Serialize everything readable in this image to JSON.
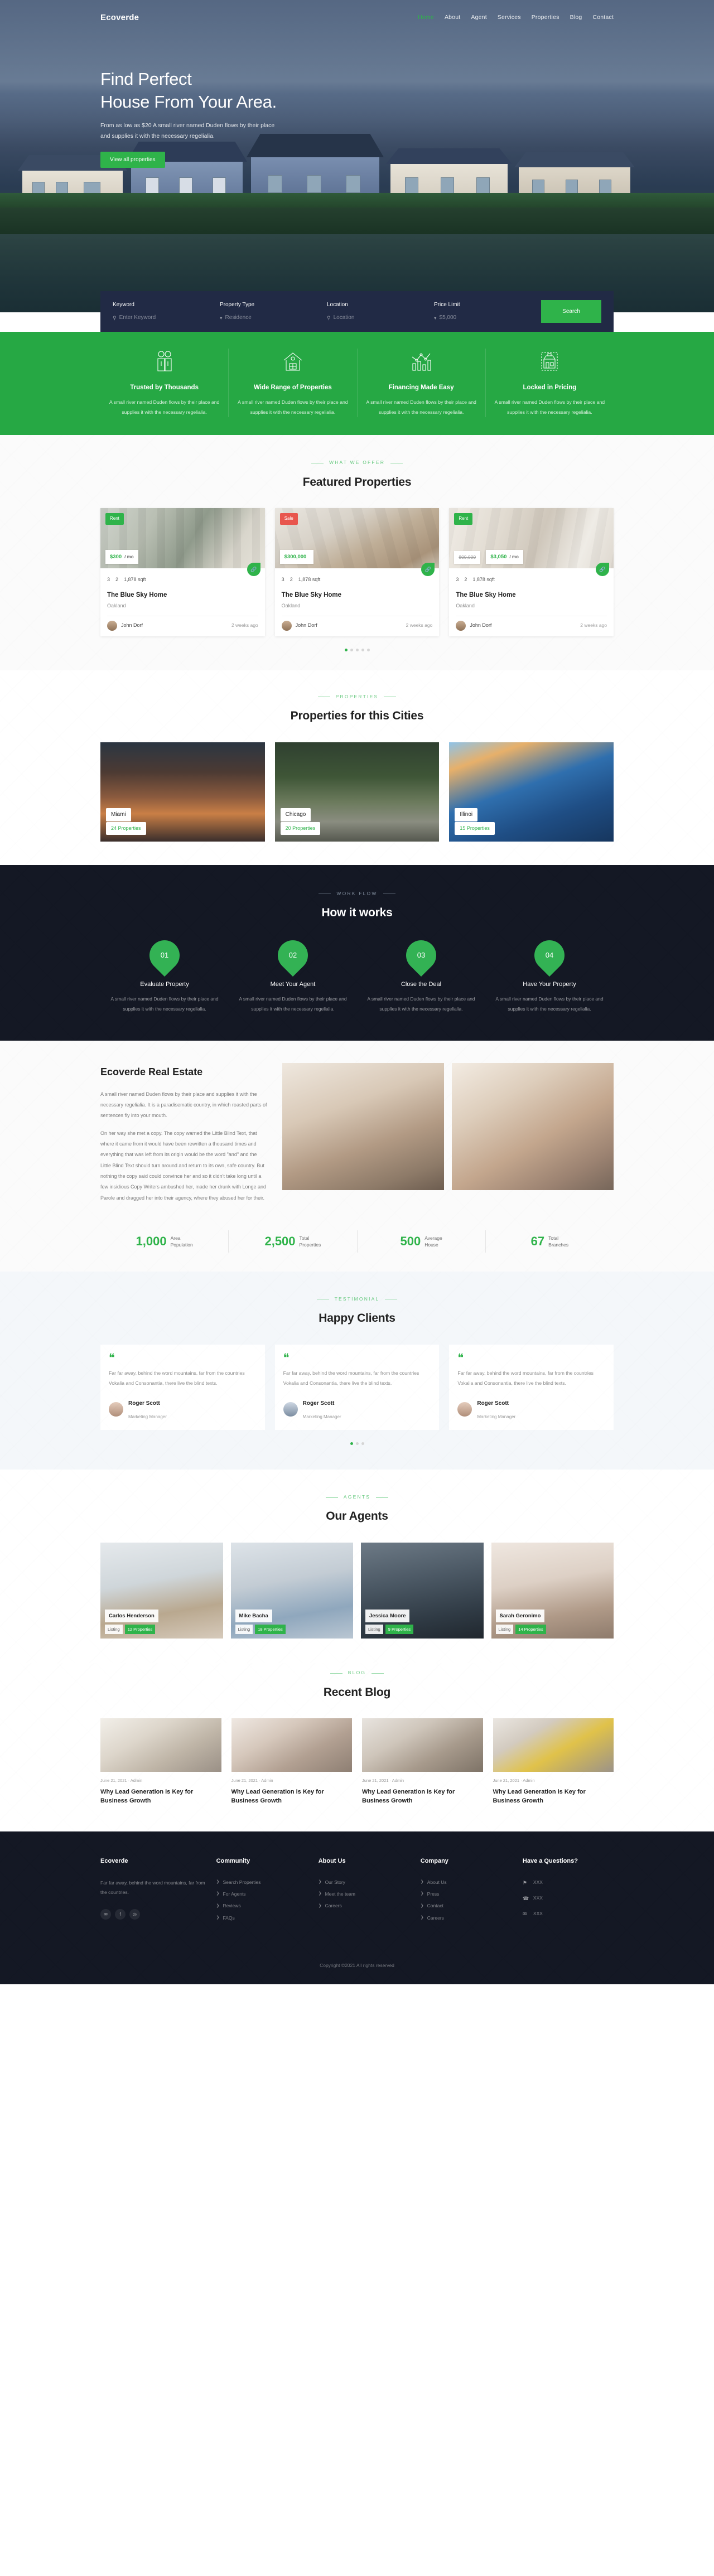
{
  "brand": {
    "name": "Ecoverde"
  },
  "nav": {
    "items": [
      {
        "label": "Home",
        "active": true
      },
      {
        "label": "About",
        "active": false
      },
      {
        "label": "Agent",
        "active": false
      },
      {
        "label": "Services",
        "active": false
      },
      {
        "label": "Properties",
        "active": false
      },
      {
        "label": "Blog",
        "active": false
      },
      {
        "label": "Contact",
        "active": false
      }
    ]
  },
  "hero": {
    "title_line1": "Find Perfect",
    "title_line2": "House From Your Area.",
    "subtitle": "From as low as $20 A small river named Duden flows by their place and supplies it with the necessary regelialia.",
    "cta": "View all properties"
  },
  "search": {
    "fields": [
      {
        "label": "Keyword",
        "value": "Enter Keyword",
        "icon": "search-icon"
      },
      {
        "label": "Property Type",
        "value": "Residence",
        "icon": "chevron-down-icon"
      },
      {
        "label": "Location",
        "value": "Location",
        "icon": "search-icon"
      },
      {
        "label": "Price Limit",
        "value": "$5,000",
        "icon": "chevron-down-icon"
      }
    ],
    "button": "Search"
  },
  "features": {
    "items": [
      {
        "icon": "handshake-icon",
        "title": "Trusted by Thousands",
        "text": "A small river named Duden flows by their place and supplies it with the necessary regelialia."
      },
      {
        "icon": "house-icon",
        "title": "Wide Range of Properties",
        "text": "A small river named Duden flows by their place and supplies it with the necessary regelialia."
      },
      {
        "icon": "chart-icon",
        "title": "Financing Made Easy",
        "text": "A small river named Duden flows by their place and supplies it with the necessary regelialia."
      },
      {
        "icon": "storefront-icon",
        "title": "Locked in Pricing",
        "text": "A small river named Duden flows by their place and supplies it with the necessary regelialia."
      }
    ]
  },
  "featured": {
    "eyebrow": "WHAT WE OFFER",
    "title": "Featured Properties",
    "cards": [
      {
        "badge": "Rent",
        "badge_type": "rent",
        "price": "$300",
        "per": "/ mo",
        "old_price": "",
        "beds": "3",
        "baths": "2",
        "area": "1,878 sqft",
        "name": "The Blue Sky Home",
        "location": "Oakland",
        "agent": "John Dorf",
        "time": "2 weeks ago"
      },
      {
        "badge": "Sale",
        "badge_type": "sale",
        "price": "$300,000",
        "per": "",
        "old_price": "",
        "beds": "3",
        "baths": "2",
        "area": "1,878 sqft",
        "name": "The Blue Sky Home",
        "location": "Oakland",
        "agent": "John Dorf",
        "time": "2 weeks ago"
      },
      {
        "badge": "Rent",
        "badge_type": "rent",
        "price": "$3,050",
        "per": "/ mo",
        "old_price": "800,000",
        "beds": "3",
        "baths": "2",
        "area": "1,878 sqft",
        "name": "The Blue Sky Home",
        "location": "Oakland",
        "agent": "John Dorf",
        "time": "2 weeks ago"
      }
    ]
  },
  "cities": {
    "eyebrow": "PROPERTIES",
    "title": "Properties for this Cities",
    "items": [
      {
        "name": "Miami",
        "count": "24 Properties"
      },
      {
        "name": "Chicago",
        "count": "20 Properties"
      },
      {
        "name": "Illinoi",
        "count": "15 Properties"
      }
    ]
  },
  "howitworks": {
    "eyebrow": "WORK FLOW",
    "title": "How it works",
    "steps": [
      {
        "num": "01",
        "title": "Evaluate Property",
        "text": "A small river named Duden flows by their place and supplies it with the necessary regelialia."
      },
      {
        "num": "02",
        "title": "Meet Your Agent",
        "text": "A small river named Duden flows by their place and supplies it with the necessary regelialia."
      },
      {
        "num": "03",
        "title": "Close the Deal",
        "text": "A small river named Duden flows by their place and supplies it with the necessary regelialia."
      },
      {
        "num": "04",
        "title": "Have Your Property",
        "text": "A small river named Duden flows by their place and supplies it with the necessary regelialia."
      }
    ]
  },
  "about": {
    "title": "Ecoverde Real Estate",
    "p1": "A small river named Duden flows by their place and supplies it with the necessary regelialia. It is a paradisematic country, in which roasted parts of sentences fly into your mouth.",
    "p2": "On her way she met a copy. The copy warned the Little Blind Text, that where it came from it would have been rewritten a thousand times and everything that was left from its origin would be the word \"and\" and the Little Blind Text should turn around and return to its own, safe country. But nothing the copy said could convince her and so it didn't take long until a few insidious Copy Writers ambushed her, made her drunk with Longe and Parole and dragged her into their agency, where they abused her for their."
  },
  "stats": {
    "items": [
      {
        "num": "1,000",
        "label1": "Area",
        "label2": "Population"
      },
      {
        "num": "2,500",
        "label1": "Total",
        "label2": "Properties"
      },
      {
        "num": "500",
        "label1": "Average",
        "label2": "House"
      },
      {
        "num": "67",
        "label1": "Total",
        "label2": "Branches"
      }
    ]
  },
  "testimonials": {
    "eyebrow": "TESTIMONIAL",
    "title": "Happy Clients",
    "items": [
      {
        "text": "Far far away, behind the word mountains, far from the countries Vokalia and Consonantia, there live the blind texts.",
        "name": "Roger Scott",
        "role": "Marketing Manager"
      },
      {
        "text": "Far far away, behind the word mountains, far from the countries Vokalia and Consonantia, there live the blind texts.",
        "name": "Roger Scott",
        "role": "Marketing Manager"
      },
      {
        "text": "Far far away, behind the word mountains, far from the countries Vokalia and Consonantia, there live the blind texts.",
        "name": "Roger Scott",
        "role": "Marketing Manager"
      }
    ]
  },
  "agents": {
    "eyebrow": "AGENTS",
    "title": "Our Agents",
    "items": [
      {
        "name": "Carlos Henderson",
        "listing": "Listing",
        "count": "12 Properties"
      },
      {
        "name": "Mike Bacha",
        "listing": "Listing",
        "count": "18 Properties"
      },
      {
        "name": "Jessica Moore",
        "listing": "Listing",
        "count": "9 Properties"
      },
      {
        "name": "Sarah Geronimo",
        "listing": "Listing",
        "count": "14 Properties"
      }
    ]
  },
  "blog": {
    "eyebrow": "BLOG",
    "title": "Recent Blog",
    "items": [
      {
        "meta": "June 21, 2021 · Admin",
        "title": "Why Lead Generation is Key for Business Growth"
      },
      {
        "meta": "June 21, 2021 · Admin",
        "title": "Why Lead Generation is Key for Business Growth"
      },
      {
        "meta": "June 21, 2021 · Admin",
        "title": "Why Lead Generation is Key for Business Growth"
      },
      {
        "meta": "June 21, 2021 · Admin",
        "title": "Why Lead Generation is Key for Business Growth"
      }
    ]
  },
  "footer": {
    "brand": {
      "title": "Ecoverde",
      "text": "Far far away, behind the word mountains, far from the countries."
    },
    "socials": [
      {
        "icon": "twitter-icon",
        "glyph": "✉"
      },
      {
        "icon": "facebook-icon",
        "glyph": "f"
      },
      {
        "icon": "instagram-icon",
        "glyph": "◎"
      }
    ],
    "columns": [
      {
        "title": "Community",
        "links": [
          "Search Properties",
          "For Agents",
          "Reviews",
          "FAQs"
        ]
      },
      {
        "title": "About Us",
        "links": [
          "Our Story",
          "Meet the team",
          "Careers"
        ]
      },
      {
        "title": "Company",
        "links": [
          "About Us",
          "Press",
          "Contact",
          "Careers"
        ]
      }
    ],
    "contact": {
      "title": "Have a Questions?",
      "items": [
        {
          "icon": "map-marker-icon",
          "glyph": "⚑",
          "text": "XXX"
        },
        {
          "icon": "phone-icon",
          "glyph": "☎",
          "text": "XXX"
        },
        {
          "icon": "envelope-icon",
          "glyph": "✉",
          "text": "XXX"
        }
      ]
    },
    "copyright": "Copyright ©2021 All rights reserved"
  },
  "colors": {
    "accent": "#2fb34a",
    "dark": "#141824",
    "navy": "#212a45",
    "sale": "#e8564e"
  }
}
